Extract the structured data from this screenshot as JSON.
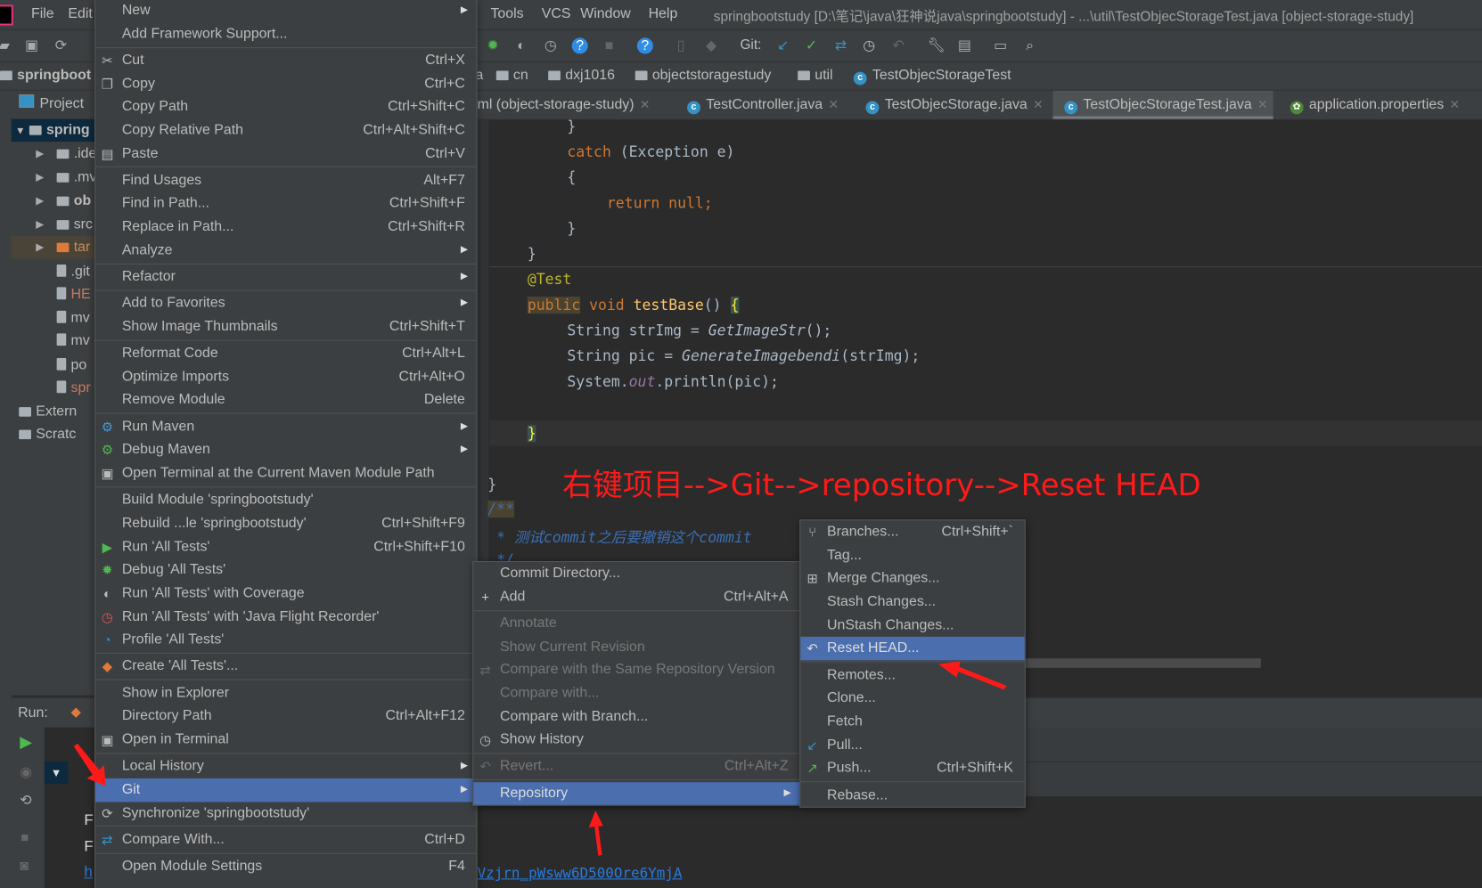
{
  "menubar": {
    "items": [
      "File",
      "Edit",
      "Tools",
      "VCS",
      "Window",
      "Help"
    ],
    "title": "springbootstudy [D:\\笔记\\java\\狂神说java\\springbootstudy] - ...\\util\\TestObjecStorageTest.java [object-storage-study]"
  },
  "toolbar": {
    "git_label": "Git:"
  },
  "breadcrumb": [
    "a",
    "cn",
    "dxj1016",
    "objectstoragestudy",
    "util",
    "TestObjecStorageTest"
  ],
  "project": {
    "root": "springboot",
    "tab": "Project",
    "tree": [
      ".idea",
      ".mvn",
      "ob",
      "src",
      "tar",
      ".git",
      "HE",
      "mv",
      "mv",
      "po",
      "spr",
      "Extern",
      "Scratc"
    ],
    "module": "spring"
  },
  "tabs": [
    {
      "label": "ml (object-storage-study)",
      "active": false
    },
    {
      "label": "TestController.java",
      "active": false
    },
    {
      "label": "TestObjecStorage.java",
      "active": false
    },
    {
      "label": "TestObjecStorageTest.java",
      "active": true
    },
    {
      "label": "application.properties",
      "active": false
    }
  ],
  "code": {
    "l1": "}",
    "l2a": "catch",
    "l2b": " (Exception e)",
    "l3": "{",
    "l4": "return null;",
    "l5": "}",
    "l6": "}",
    "l7": "@Test",
    "l8a": "public",
    "l8b": " void ",
    "l8c": "testBase",
    "l8d": "() ",
    "l8e": "{",
    "l9a": "String strImg = ",
    "l9b": "GetImageStr",
    "l9c": "();",
    "l10a": "String pic = ",
    "l10b": "GenerateImagebendi",
    "l10c": "(strImg);",
    "l11a": "System.",
    "l11b": "out",
    "l11c": ".println(pic);",
    "l12": "}",
    "l13": "}",
    "l14": "/**",
    "l15": " * 测试commit之后要撤销这个commit",
    "l16": " */"
  },
  "annotation": "右键项目-->Git-->repository-->Reset HEAD",
  "run": {
    "label": "Run:",
    "out1": "F",
    "out2": "F",
    "out3": "h",
    "link": "Vzjrn_pWsww6D500Ore6YmjA"
  },
  "main_menu": [
    {
      "label": "New",
      "submenu": true
    },
    {
      "label": "Add Framework Support..."
    },
    {
      "sep": true
    },
    {
      "label": "Cut",
      "shortcut": "Ctrl+X",
      "icon": "cut-icon"
    },
    {
      "label": "Copy",
      "shortcut": "Ctrl+C",
      "icon": "copy-icon"
    },
    {
      "label": "Copy Path",
      "shortcut": "Ctrl+Shift+C"
    },
    {
      "label": "Copy Relative Path",
      "shortcut": "Ctrl+Alt+Shift+C"
    },
    {
      "label": "Paste",
      "shortcut": "Ctrl+V",
      "icon": "paste-icon"
    },
    {
      "sep": true
    },
    {
      "label": "Find Usages",
      "shortcut": "Alt+F7"
    },
    {
      "label": "Find in Path...",
      "shortcut": "Ctrl+Shift+F"
    },
    {
      "label": "Replace in Path...",
      "shortcut": "Ctrl+Shift+R"
    },
    {
      "label": "Analyze",
      "submenu": true
    },
    {
      "sep": true
    },
    {
      "label": "Refactor",
      "submenu": true
    },
    {
      "sep": true
    },
    {
      "label": "Add to Favorites",
      "submenu": true
    },
    {
      "label": "Show Image Thumbnails",
      "shortcut": "Ctrl+Shift+T"
    },
    {
      "sep": true
    },
    {
      "label": "Reformat Code",
      "shortcut": "Ctrl+Alt+L"
    },
    {
      "label": "Optimize Imports",
      "shortcut": "Ctrl+Alt+O"
    },
    {
      "label": "Remove Module",
      "shortcut": "Delete"
    },
    {
      "sep": true
    },
    {
      "label": "Run Maven",
      "submenu": true,
      "icon": "gear-icon"
    },
    {
      "label": "Debug Maven",
      "submenu": true,
      "icon": "debug-gear-icon"
    },
    {
      "label": "Open Terminal at the Current Maven Module Path",
      "icon": "terminal-icon"
    },
    {
      "sep": true
    },
    {
      "label": "Build Module 'springbootstudy'"
    },
    {
      "label": "Rebuild ...le 'springbootstudy'",
      "shortcut": "Ctrl+Shift+F9"
    },
    {
      "label": "Run 'All Tests'",
      "shortcut": "Ctrl+Shift+F10",
      "icon": "run-icon"
    },
    {
      "label": "Debug 'All Tests'",
      "icon": "debug-icon"
    },
    {
      "label": "Run 'All Tests' with Coverage",
      "icon": "coverage-icon"
    },
    {
      "label": "Run 'All Tests' with 'Java Flight Recorder'",
      "icon": "flight-recorder-icon"
    },
    {
      "label": "Profile 'All Tests'",
      "icon": "profile-icon"
    },
    {
      "sep": true
    },
    {
      "label": "Create 'All Tests'...",
      "icon": "create-test-icon"
    },
    {
      "sep": true
    },
    {
      "label": "Show in Explorer"
    },
    {
      "label": "Directory Path",
      "shortcut": "Ctrl+Alt+F12"
    },
    {
      "label": "Open in Terminal",
      "icon": "terminal-icon"
    },
    {
      "sep": true
    },
    {
      "label": "Local History",
      "submenu": true
    },
    {
      "label": "Git",
      "submenu": true,
      "highlighted": true
    },
    {
      "label": "Synchronize 'springbootstudy'",
      "icon": "sync-icon"
    },
    {
      "sep": true
    },
    {
      "label": "Compare With...",
      "shortcut": "Ctrl+D",
      "icon": "compare-icon"
    },
    {
      "sep": true
    },
    {
      "label": "Open Module Settings",
      "shortcut": "F4"
    }
  ],
  "git_menu": [
    {
      "label": "Commit Directory..."
    },
    {
      "label": "Add",
      "shortcut": "Ctrl+Alt+A",
      "icon": "plus-icon"
    },
    {
      "sep": true
    },
    {
      "label": "Annotate",
      "disabled": true
    },
    {
      "label": "Show Current Revision",
      "disabled": true
    },
    {
      "label": "Compare with the Same Repository Version",
      "disabled": true,
      "icon": "compare-icon"
    },
    {
      "label": "Compare with...",
      "disabled": true
    },
    {
      "label": "Compare with Branch..."
    },
    {
      "label": "Show History",
      "icon": "clock-icon"
    },
    {
      "sep": true
    },
    {
      "label": "Revert...",
      "shortcut": "Ctrl+Alt+Z",
      "disabled": true,
      "icon": "revert-icon"
    },
    {
      "sep": true
    },
    {
      "label": "Repository",
      "submenu": true,
      "highlighted": true
    }
  ],
  "repo_menu": [
    {
      "label": "Branches...",
      "shortcut": "Ctrl+Shift+`",
      "icon": "branch-icon"
    },
    {
      "label": "Tag..."
    },
    {
      "label": "Merge Changes...",
      "icon": "merge-icon"
    },
    {
      "label": "Stash Changes..."
    },
    {
      "label": "UnStash Changes..."
    },
    {
      "label": "Reset HEAD...",
      "highlighted": true,
      "icon": "reset-icon"
    },
    {
      "sep": true
    },
    {
      "label": "Remotes..."
    },
    {
      "label": "Clone..."
    },
    {
      "label": "Fetch"
    },
    {
      "label": "Pull...",
      "icon": "pull-icon"
    },
    {
      "label": "Push...",
      "shortcut": "Ctrl+Shift+K",
      "icon": "push-icon"
    },
    {
      "sep": true
    },
    {
      "label": "Rebase..."
    }
  ],
  "colors": {
    "highlight": "#4b6eaf",
    "menu_bg": "#3c3f41",
    "editor_bg": "#2b2b2b",
    "annotation": "#ff1a1a"
  }
}
